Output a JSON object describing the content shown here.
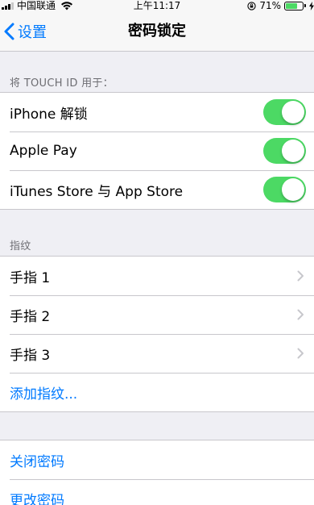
{
  "status_bar": {
    "carrier": "中国联通",
    "time": "上午11:17",
    "battery_percent": "71%",
    "battery_level": 0.71,
    "battery_color": "#4cd964"
  },
  "nav": {
    "back_label": "设置",
    "title": "密码锁定"
  },
  "touch_id_section": {
    "header": "将 TOUCH ID 用于：",
    "items": [
      {
        "label": "iPhone 解锁",
        "enabled": true
      },
      {
        "label": "Apple Pay",
        "enabled": true
      },
      {
        "label": "iTunes Store 与 App Store",
        "enabled": true
      }
    ]
  },
  "fingerprint_section": {
    "header": "指纹",
    "fingers": [
      {
        "label": "手指 1",
        "icon": "chevron-right-icon"
      },
      {
        "label": "手指 2",
        "icon": "chevron-right-icon"
      },
      {
        "label": "手指 3",
        "icon": "chevron-right-icon"
      }
    ],
    "add_label": "添加指纹..."
  },
  "passcode_section": {
    "turn_off_label": "关闭密码",
    "change_label": "更改密码"
  },
  "colors": {
    "accent": "#007aff",
    "toggle_on": "#4cd964",
    "background": "#efeff4"
  }
}
